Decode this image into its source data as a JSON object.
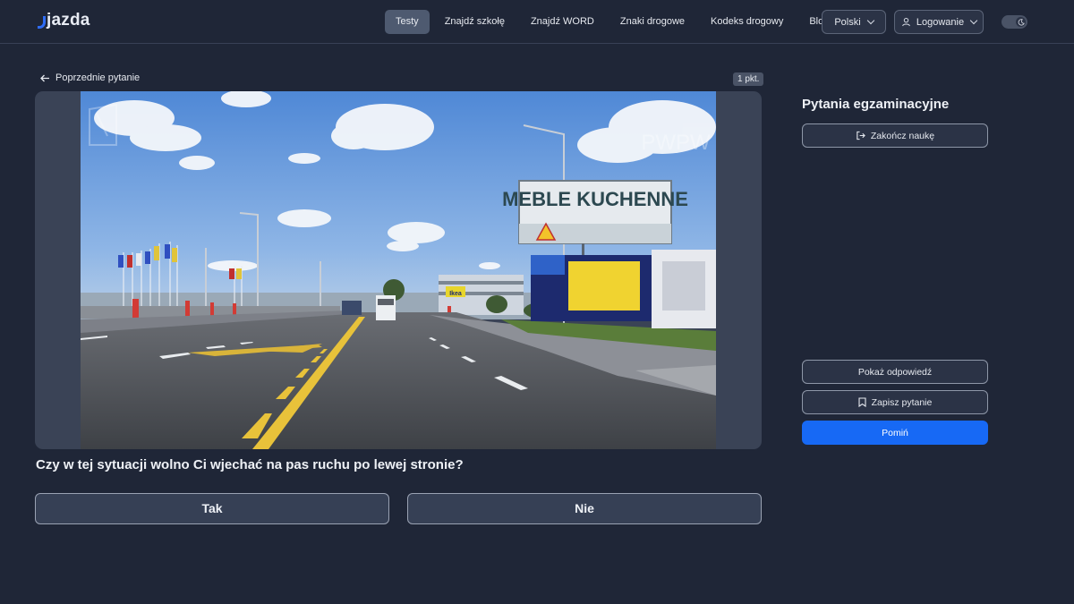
{
  "header": {
    "logo": "jazda",
    "nav": [
      {
        "label": "Testy",
        "active": true
      },
      {
        "label": "Znajdź szkołę",
        "active": false
      },
      {
        "label": "Znajdź WORD",
        "active": false
      },
      {
        "label": "Znaki drogowe",
        "active": false
      },
      {
        "label": "Kodeks drogowy",
        "active": false
      },
      {
        "label": "Blog",
        "active": false
      }
    ],
    "language": "Polski",
    "login": "Logowanie",
    "theme_toggle_icon": "moon-icon"
  },
  "main": {
    "back_label": "Poprzednie pytanie",
    "points": "1 pkt.",
    "image": {
      "billboard_text": "MEBLE KUCHENNE",
      "watermark": "PWPW",
      "sign_text": "Ikea"
    },
    "question": "Czy w tej sytuacji wolno Ci wjechać na pas ruchu po lewej stronie?",
    "answers": [
      "Tak",
      "Nie"
    ]
  },
  "sidebar": {
    "title": "Pytania egzaminacyjne",
    "end_label": "Zakończ naukę",
    "show_answer_label": "Pokaż odpowiedź",
    "save_label": "Zapisz pytanie",
    "skip_label": "Pomiń"
  },
  "colors": {
    "background": "#1f2637",
    "accent": "#1769f5",
    "card": "#3a4356"
  }
}
